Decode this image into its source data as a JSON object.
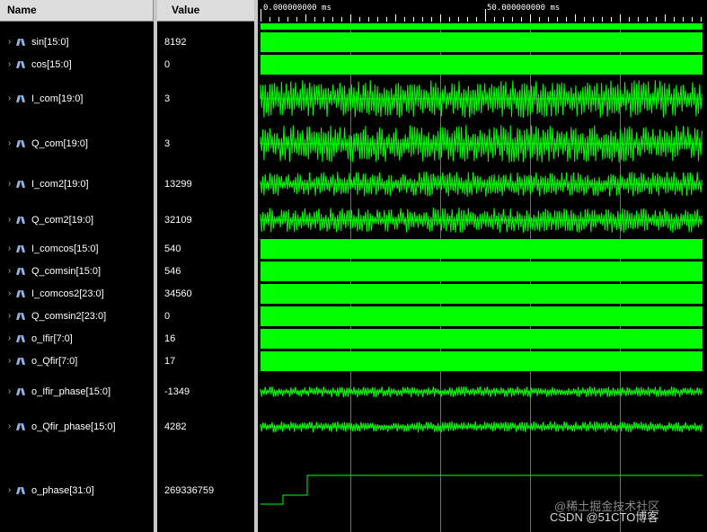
{
  "columns": {
    "name": "Name",
    "value": "Value"
  },
  "timeline": {
    "start_label": "0.000000000 ms",
    "mid_label": "50.000000000 ms"
  },
  "colors": {
    "wave": "#00ff00",
    "grid": "#707070",
    "background": "#000000"
  },
  "signals": [
    {
      "name": "sin[15:0]",
      "value": "8192",
      "wave": "bus"
    },
    {
      "name": "cos[15:0]",
      "value": "0",
      "wave": "bus"
    },
    {
      "name": "I_com[19:0]",
      "value": "3",
      "wave": "noise"
    },
    {
      "name": "Q_com[19:0]",
      "value": "3",
      "wave": "noise"
    },
    {
      "name": "I_com2[19:0]",
      "value": "13299",
      "wave": "noise"
    },
    {
      "name": "Q_com2[19:0]",
      "value": "32109",
      "wave": "noise"
    },
    {
      "name": "I_comcos[15:0]",
      "value": "540",
      "wave": "bus"
    },
    {
      "name": "Q_comsin[15:0]",
      "value": "546",
      "wave": "bus"
    },
    {
      "name": "I_comcos2[23:0]",
      "value": "34560",
      "wave": "bus"
    },
    {
      "name": "Q_comsin2[23:0]",
      "value": "0",
      "wave": "bus"
    },
    {
      "name": "o_Ifir[7:0]",
      "value": "16",
      "wave": "bus"
    },
    {
      "name": "o_Qfir[7:0]",
      "value": "17",
      "wave": "bus"
    },
    {
      "name": "o_Ifir_phase[15:0]",
      "value": "-1349",
      "wave": "noise"
    },
    {
      "name": "o_Qfir_phase[15:0]",
      "value": "4282",
      "wave": "noise"
    },
    {
      "name": "o_phase[31:0]",
      "value": "269336759",
      "wave": "step"
    }
  ],
  "watermark": {
    "line1": "@稀土掘金技术社区",
    "line2": "CSDN @51CTO博客"
  }
}
